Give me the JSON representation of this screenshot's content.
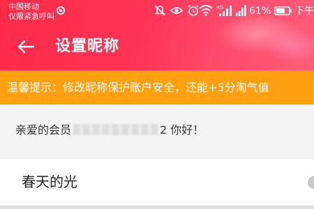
{
  "status_bar": {
    "carrier_line1": "中国移动",
    "carrier_line2": "仅限紧急呼叫",
    "battery_percent": "61%",
    "time": "下午"
  },
  "header": {
    "title": "设置昵称"
  },
  "notice": {
    "text": "温馨提示：修改昵称保护账户安全，还能+5分淘气值"
  },
  "greeting": {
    "prefix": "亲爱的会员",
    "suffix": "2 你好！"
  },
  "nickname_input": {
    "value": "春天的光"
  },
  "colors": {
    "header": "#ff3355",
    "notice": "#ffa010",
    "background": "#f4f4f4"
  }
}
